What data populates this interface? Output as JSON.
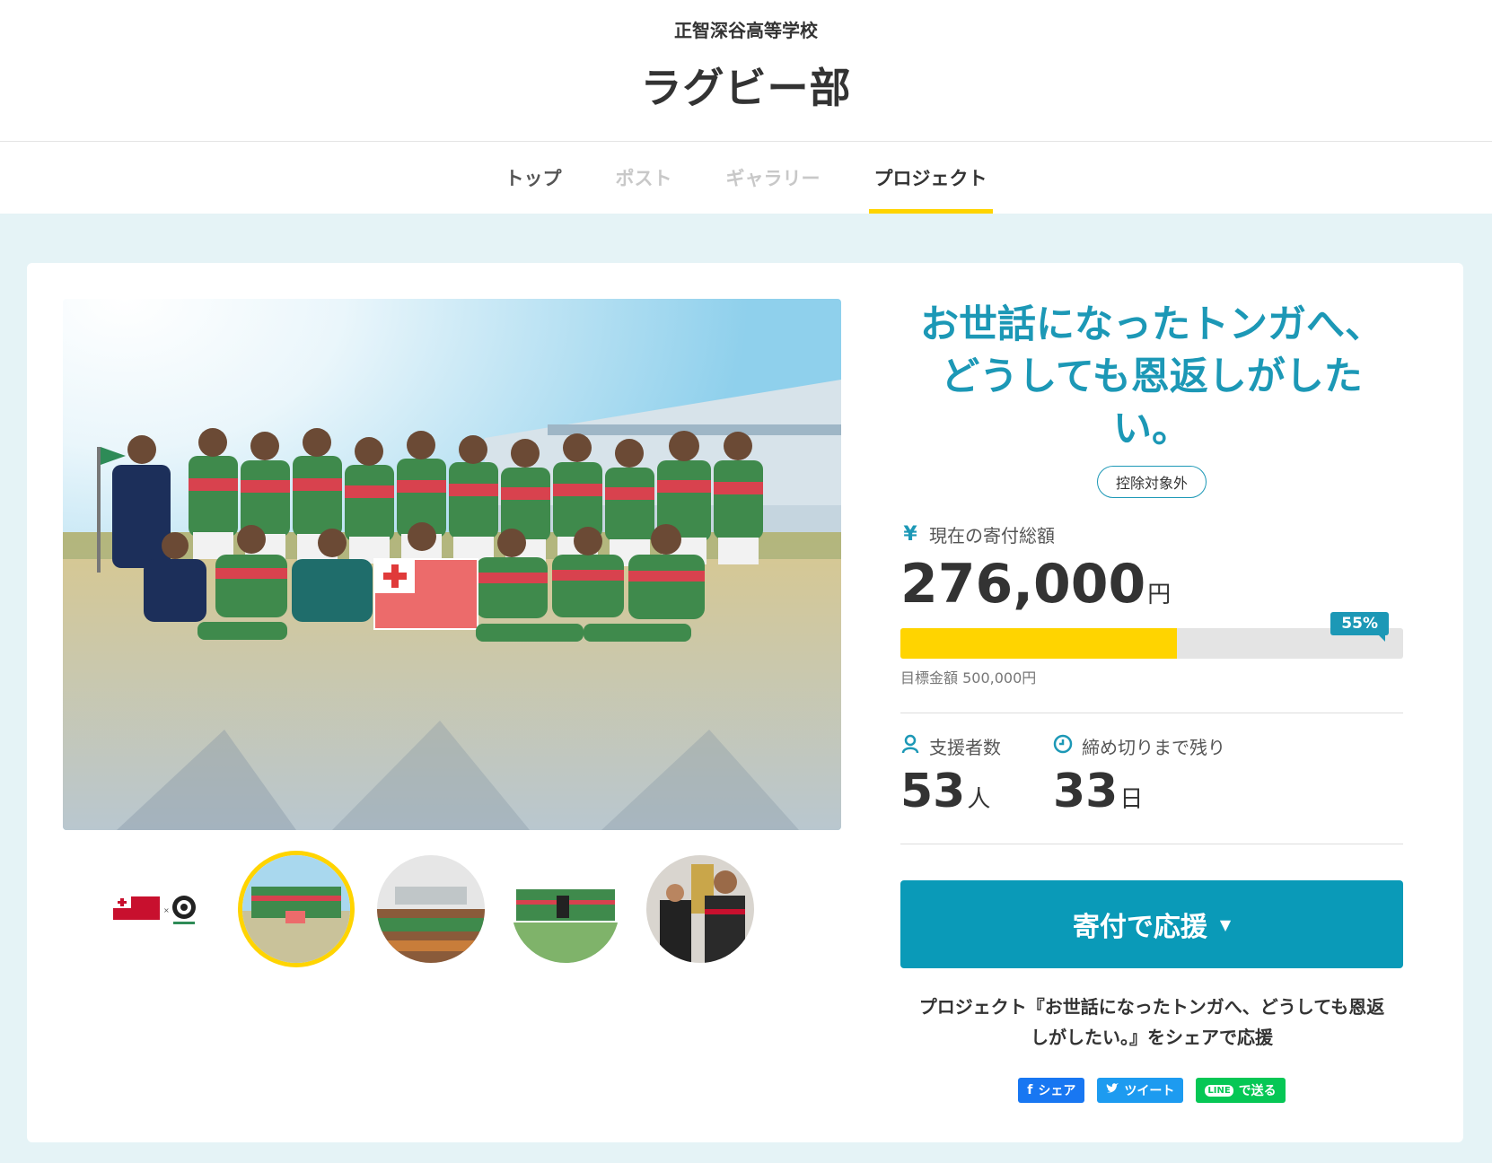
{
  "header": {
    "school": "正智深谷高等学校",
    "club": "ラグビー部"
  },
  "tabs": [
    {
      "label": "トップ"
    },
    {
      "label": "ポスト"
    },
    {
      "label": "ギャラリー"
    },
    {
      "label": "プロジェクト"
    }
  ],
  "active_tab": "プロジェクト",
  "project": {
    "title_line1": "お世話になったトンガへ、",
    "title_line2": "どうしても恩返しがした",
    "title_line3": "い。",
    "badge": "控除対象外",
    "current_label": "現在の寄付総額",
    "current_icon": "yen-icon",
    "current_amount": "276,000",
    "currency_unit": "円",
    "progress_percent": 55,
    "progress_label": "55%",
    "goal_text": "目標金額 500,000円",
    "supporters_label": "支援者数",
    "supporters_icon": "person-icon",
    "supporters_count": "53",
    "supporters_unit": "人",
    "deadline_label": "締め切りまで残り",
    "deadline_icon": "clock-icon",
    "days_left": "33",
    "days_unit": "日",
    "donate_label": "寄付で応援",
    "share_text_line1": "プロジェクト『お世話になったトンガへ、どうしても恩返",
    "share_text_line2": "しがしたい。』をシェアで応援"
  },
  "social": {
    "facebook": "シェア",
    "twitter": "ツイート",
    "line_badge": "LINE",
    "line": "で送る"
  },
  "colors": {
    "accent": "#1c98b6",
    "highlight": "#ffd400",
    "button": "#0a9ab8",
    "background": "#e5f3f6"
  }
}
